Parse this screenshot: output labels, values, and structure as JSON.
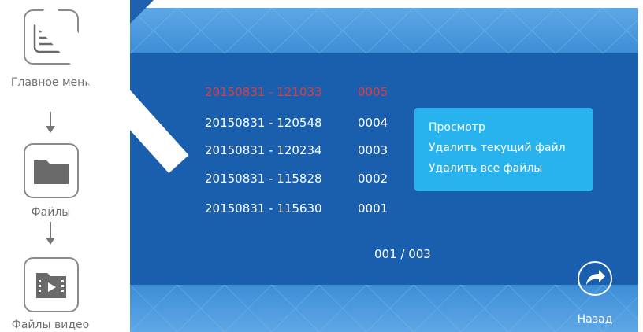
{
  "sidebar": {
    "items": [
      {
        "label": "Главное меню",
        "icon": "menu-lines-icon"
      },
      {
        "label": "Файлы",
        "icon": "folder-icon"
      },
      {
        "label": "Файлы видео",
        "icon": "video-folder-icon"
      }
    ]
  },
  "files": [
    {
      "date": "20150831 - 121033",
      "num": "0005",
      "selected": true
    },
    {
      "date": "20150831 - 120548",
      "num": "0004"
    },
    {
      "date": "20150831 - 120234",
      "num": "0003"
    },
    {
      "date": "20150831 - 115828",
      "num": "0002"
    },
    {
      "date": "20150831 - 115630",
      "num": "0001"
    }
  ],
  "context_menu": {
    "items": [
      "Просмотр",
      "Удалить текущий файл",
      "Удалить все файлы"
    ]
  },
  "pager": "001 / 003",
  "back": {
    "label": "Назад",
    "icon": "back-arrow-icon"
  },
  "colors": {
    "panel": "#3d8ed6",
    "panel_dark": "#1a5fad",
    "menu": "#29b3ee",
    "selected": "#e23a3a"
  }
}
